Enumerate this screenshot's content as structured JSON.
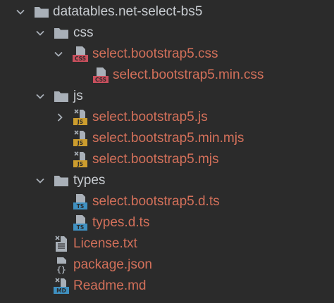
{
  "tree": {
    "root": {
      "label": "datatables.net-select-bs5",
      "icon": "folder-icon",
      "expanded": true
    },
    "css_folder": {
      "label": "css",
      "icon": "folder-icon",
      "expanded": true
    },
    "css_file": {
      "label": "select.bootstrap5.css",
      "icon": "css-file-icon",
      "badge": "CSS",
      "expanded": true
    },
    "css_min_file": {
      "label": "select.bootstrap5.min.css",
      "icon": "css-file-icon",
      "badge": "CSS"
    },
    "js_folder": {
      "label": "js",
      "icon": "folder-icon",
      "expanded": true
    },
    "js_file": {
      "label": "select.bootstrap5.js",
      "icon": "js-file-icon",
      "badge": "JS",
      "expanded": false
    },
    "js_min_mjs_file": {
      "label": "select.bootstrap5.min.mjs",
      "icon": "js-file-icon",
      "badge": "JS"
    },
    "js_mjs_file": {
      "label": "select.bootstrap5.mjs",
      "icon": "js-file-icon",
      "badge": "JS"
    },
    "types_folder": {
      "label": "types",
      "icon": "folder-icon",
      "expanded": true
    },
    "dts_file": {
      "label": "select.bootstrap5.d.ts",
      "icon": "ts-file-icon",
      "badge": "TS"
    },
    "types_file": {
      "label": "types.d.ts",
      "icon": "ts-file-icon",
      "badge": "TS"
    },
    "license_file": {
      "label": "License.txt",
      "icon": "text-file-icon"
    },
    "package_file": {
      "label": "package.json",
      "icon": "json-file-icon"
    },
    "readme_file": {
      "label": "Readme.md",
      "icon": "markdown-file-icon",
      "badge": "MD"
    }
  },
  "colors": {
    "background": "#2b2b2b",
    "folder_label": "#c8ccd1",
    "file_label_modified": "#d3705a",
    "folder_icon": "#a9b0b8",
    "css_badge": "#c94f5d",
    "js_badge": "#cc9d2e",
    "ts_badge": "#3f90c1",
    "md_badge": "#3f90c1"
  }
}
